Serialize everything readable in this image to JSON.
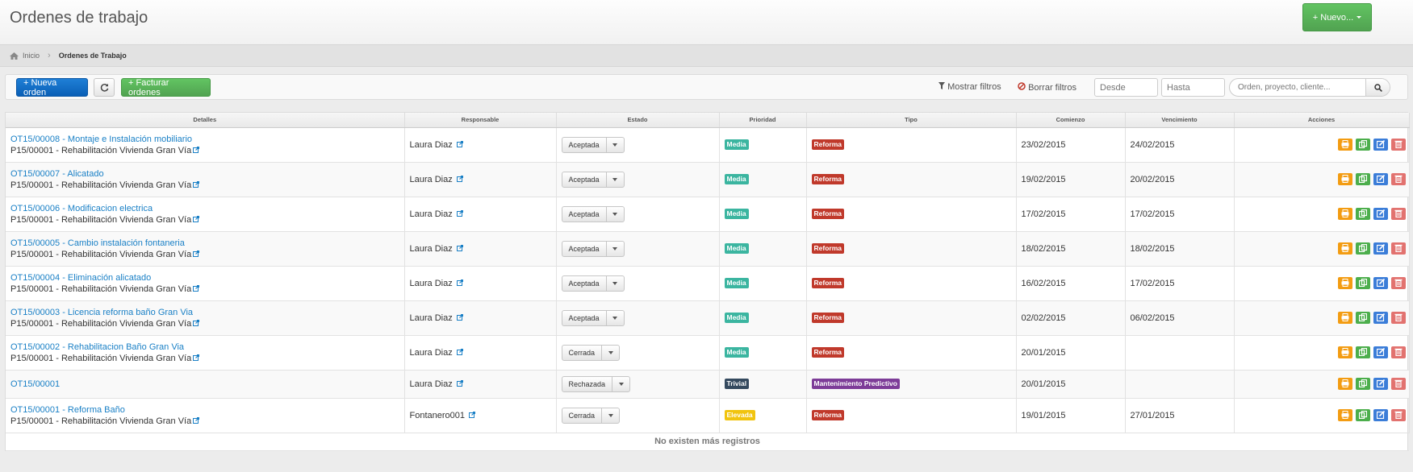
{
  "header": {
    "title": "Ordenes de trabajo",
    "new_button": "+ Nuevo..."
  },
  "breadcrumb": {
    "home": "Inicio",
    "current": "Ordenes de Trabajo"
  },
  "toolbar": {
    "new_order": "+ Nueva orden",
    "invoice_orders": "+ Facturar ordenes",
    "show_filters": "Mostrar filtros",
    "clear_filters": "Borrar filtros",
    "from_placeholder": "Desde",
    "to_placeholder": "Hasta",
    "search_placeholder": "Orden, proyecto, cliente..."
  },
  "table": {
    "columns": [
      "Detalles",
      "Responsable",
      "Estado",
      "Prioridad",
      "Tipo",
      "Comienzo",
      "Vencimiento",
      "Acciones"
    ],
    "rows": [
      {
        "title": "OT15/00008 - Montaje e Instalación mobiliario",
        "project": "P15/00001 - Rehabilitación Vivienda Gran Vía",
        "responsible": "Laura Diaz",
        "status": "Aceptada",
        "priority": "Media",
        "type": "Reforma",
        "start": "23/02/2015",
        "due": "24/02/2015"
      },
      {
        "title": "OT15/00007 - Alicatado",
        "project": "P15/00001 - Rehabilitación Vivienda Gran Vía",
        "responsible": "Laura Diaz",
        "status": "Aceptada",
        "priority": "Media",
        "type": "Reforma",
        "start": "19/02/2015",
        "due": "20/02/2015"
      },
      {
        "title": "OT15/00006 - Modificacion electrica",
        "project": "P15/00001 - Rehabilitación Vivienda Gran Vía",
        "responsible": "Laura Diaz",
        "status": "Aceptada",
        "priority": "Media",
        "type": "Reforma",
        "start": "17/02/2015",
        "due": "17/02/2015"
      },
      {
        "title": "OT15/00005 - Cambio instalación fontaneria",
        "project": "P15/00001 - Rehabilitación Vivienda Gran Vía",
        "responsible": "Laura Diaz",
        "status": "Aceptada",
        "priority": "Media",
        "type": "Reforma",
        "start": "18/02/2015",
        "due": "18/02/2015"
      },
      {
        "title": "OT15/00004 - Eliminación alicatado",
        "project": "P15/00001 - Rehabilitación Vivienda Gran Vía",
        "responsible": "Laura Diaz",
        "status": "Aceptada",
        "priority": "Media",
        "type": "Reforma",
        "start": "16/02/2015",
        "due": "17/02/2015"
      },
      {
        "title": "OT15/00003 - Licencia reforma baño Gran Via",
        "project": "P15/00001 - Rehabilitación Vivienda Gran Vía",
        "responsible": "Laura Diaz",
        "status": "Aceptada",
        "priority": "Media",
        "type": "Reforma",
        "start": "02/02/2015",
        "due": "06/02/2015"
      },
      {
        "title": "OT15/00002 - Rehabilitacion Baño Gran Via",
        "project": "P15/00001 - Rehabilitación Vivienda Gran Vía",
        "responsible": "Laura Diaz",
        "status": "Cerrada",
        "priority": "Media",
        "type": "Reforma",
        "start": "20/01/2015",
        "due": ""
      },
      {
        "title": "OT15/00001",
        "project": "",
        "responsible": "Laura Diaz",
        "status": "Rechazada",
        "priority": "Trivial",
        "type": "Mantenimiento Predictivo",
        "start": "20/01/2015",
        "due": ""
      },
      {
        "title": "OT15/00001 - Reforma Baño",
        "project": "P15/00001 - Rehabilitación Vivienda Gran Vía",
        "responsible": "Fontanero001",
        "status": "Cerrada",
        "priority": "Elevada",
        "type": "Reforma",
        "start": "19/01/2015",
        "due": "27/01/2015"
      }
    ],
    "footer": "No existen más registros"
  },
  "colors": {
    "priority": {
      "Media": "#3bb5a0",
      "Trivial": "#34495e",
      "Elevada": "#f1c40f"
    },
    "type": {
      "Reforma": "#c0392b",
      "Mantenimiento Predictivo": "#7d3c98"
    },
    "actions": {
      "print": "#f39c12",
      "copy": "#4cae4c",
      "edit": "#3b7dd8",
      "delete": "#e2726f"
    }
  },
  "icons": {
    "row_actions": [
      "print-icon",
      "copy-icon",
      "edit-icon",
      "delete-icon"
    ]
  }
}
